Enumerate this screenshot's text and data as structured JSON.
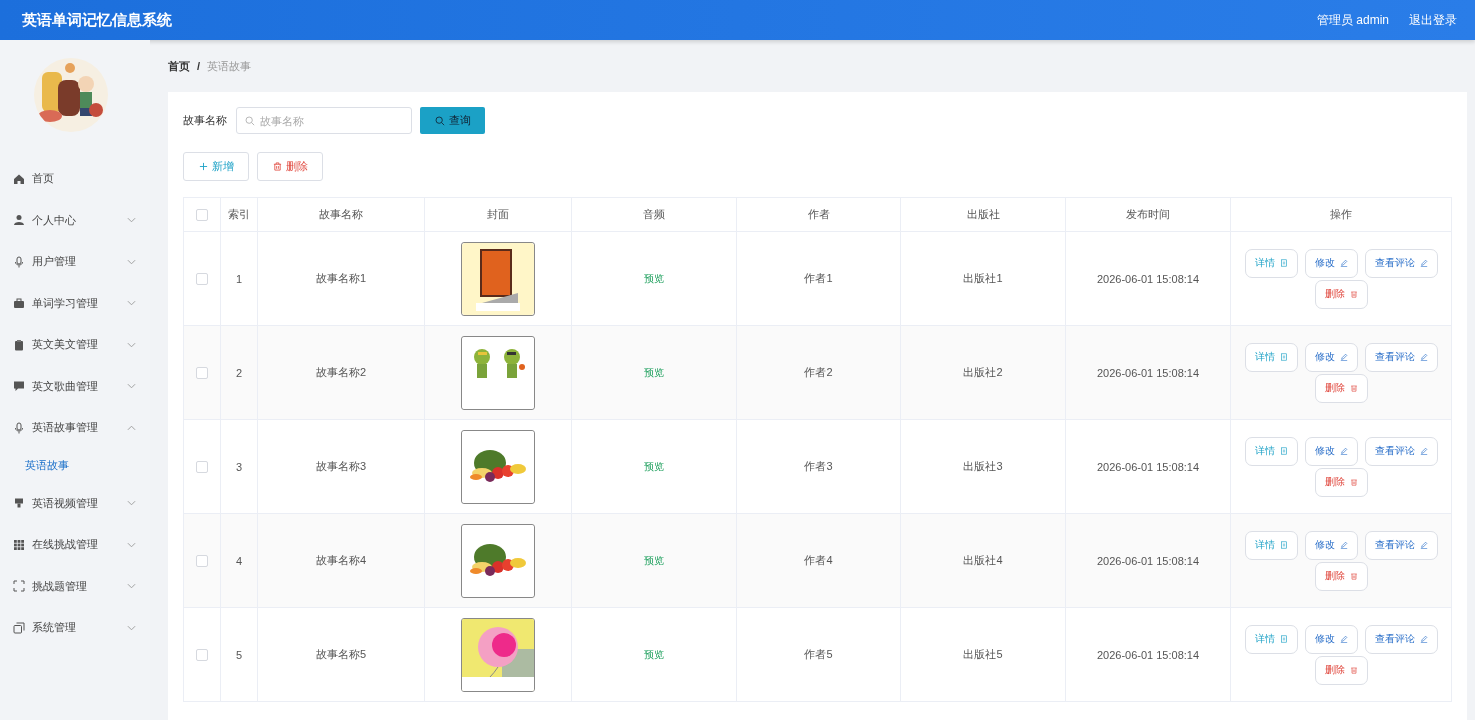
{
  "header": {
    "title": "英语单词记忆信息系统",
    "user": "管理员 admin",
    "logout": "退出登录"
  },
  "sidebar": {
    "avatar": {
      "kind": "picture"
    },
    "items": [
      {
        "label": "首页",
        "kind": "link"
      },
      {
        "label": "个人中心",
        "kind": "menu",
        "expanded": false
      },
      {
        "label": "用户管理",
        "kind": "menu",
        "expanded": false
      },
      {
        "label": "单词学习管理",
        "kind": "menu",
        "expanded": false
      },
      {
        "label": "英文美文管理",
        "kind": "menu",
        "expanded": false
      },
      {
        "label": "英文歌曲管理",
        "kind": "menu",
        "expanded": false
      },
      {
        "label": "英语故事管理",
        "kind": "menu",
        "expanded": true,
        "children": [
          {
            "label": "英语故事",
            "selected": true
          }
        ]
      },
      {
        "label": "英语视频管理",
        "kind": "menu",
        "expanded": false
      },
      {
        "label": "在线挑战管理",
        "kind": "menu",
        "expanded": false
      },
      {
        "label": "挑战题管理",
        "kind": "menu",
        "expanded": false
      },
      {
        "label": "系统管理",
        "kind": "menu",
        "expanded": false
      }
    ]
  },
  "breadcrumb": {
    "separator": "/",
    "items": [
      "首页",
      "英语故事"
    ]
  },
  "search": {
    "label": "故事名称",
    "placeholder": "故事名称",
    "button": "查询"
  },
  "toolbar": [
    {
      "kind": "add",
      "label": "新增"
    },
    {
      "kind": "delete",
      "label": "删除"
    }
  ],
  "table": {
    "all_checked": false,
    "columns": [
      "索引",
      "故事名称",
      "封面",
      "音频",
      "作者",
      "出版社",
      "发布时间",
      "操作"
    ],
    "rows": [
      {
        "index": "1",
        "name": "故事名称1",
        "cover": {
          "kind": "picture"
        },
        "audio": "预览",
        "author": "作者1",
        "publisher": "出版社1",
        "time": "2026-06-01 15:08:14",
        "checked": false,
        "actions": [
          {
            "kind": "detail",
            "label": "详情"
          },
          {
            "kind": "edit",
            "label": "修改"
          },
          {
            "kind": "comment",
            "label": "查看评论"
          },
          {
            "kind": "delete",
            "label": "删除"
          }
        ]
      },
      {
        "index": "2",
        "name": "故事名称2",
        "cover": {
          "kind": "picture"
        },
        "audio": "预览",
        "author": "作者2",
        "publisher": "出版社2",
        "time": "2026-06-01 15:08:14",
        "checked": false,
        "actions": [
          {
            "kind": "detail",
            "label": "详情"
          },
          {
            "kind": "edit",
            "label": "修改"
          },
          {
            "kind": "comment",
            "label": "查看评论"
          },
          {
            "kind": "delete",
            "label": "删除"
          }
        ]
      },
      {
        "index": "3",
        "name": "故事名称3",
        "cover": {
          "kind": "picture"
        },
        "audio": "预览",
        "author": "作者3",
        "publisher": "出版社3",
        "time": "2026-06-01 15:08:14",
        "checked": false,
        "actions": [
          {
            "kind": "detail",
            "label": "详情"
          },
          {
            "kind": "edit",
            "label": "修改"
          },
          {
            "kind": "comment",
            "label": "查看评论"
          },
          {
            "kind": "delete",
            "label": "删除"
          }
        ]
      },
      {
        "index": "4",
        "name": "故事名称4",
        "cover": {
          "kind": "picture"
        },
        "audio": "预览",
        "author": "作者4",
        "publisher": "出版社4",
        "time": "2026-06-01 15:08:14",
        "checked": false,
        "actions": [
          {
            "kind": "detail",
            "label": "详情"
          },
          {
            "kind": "edit",
            "label": "修改"
          },
          {
            "kind": "comment",
            "label": "查看评论"
          },
          {
            "kind": "delete",
            "label": "删除"
          }
        ]
      },
      {
        "index": "5",
        "name": "故事名称5",
        "cover": {
          "kind": "picture"
        },
        "audio": "预览",
        "author": "作者5",
        "publisher": "出版社5",
        "time": "2026-06-01 15:08:14",
        "checked": false,
        "actions": [
          {
            "kind": "detail",
            "label": "详情"
          },
          {
            "kind": "edit",
            "label": "修改"
          },
          {
            "kind": "comment",
            "label": "查看评论"
          },
          {
            "kind": "delete",
            "label": "删除"
          }
        ]
      }
    ]
  }
}
